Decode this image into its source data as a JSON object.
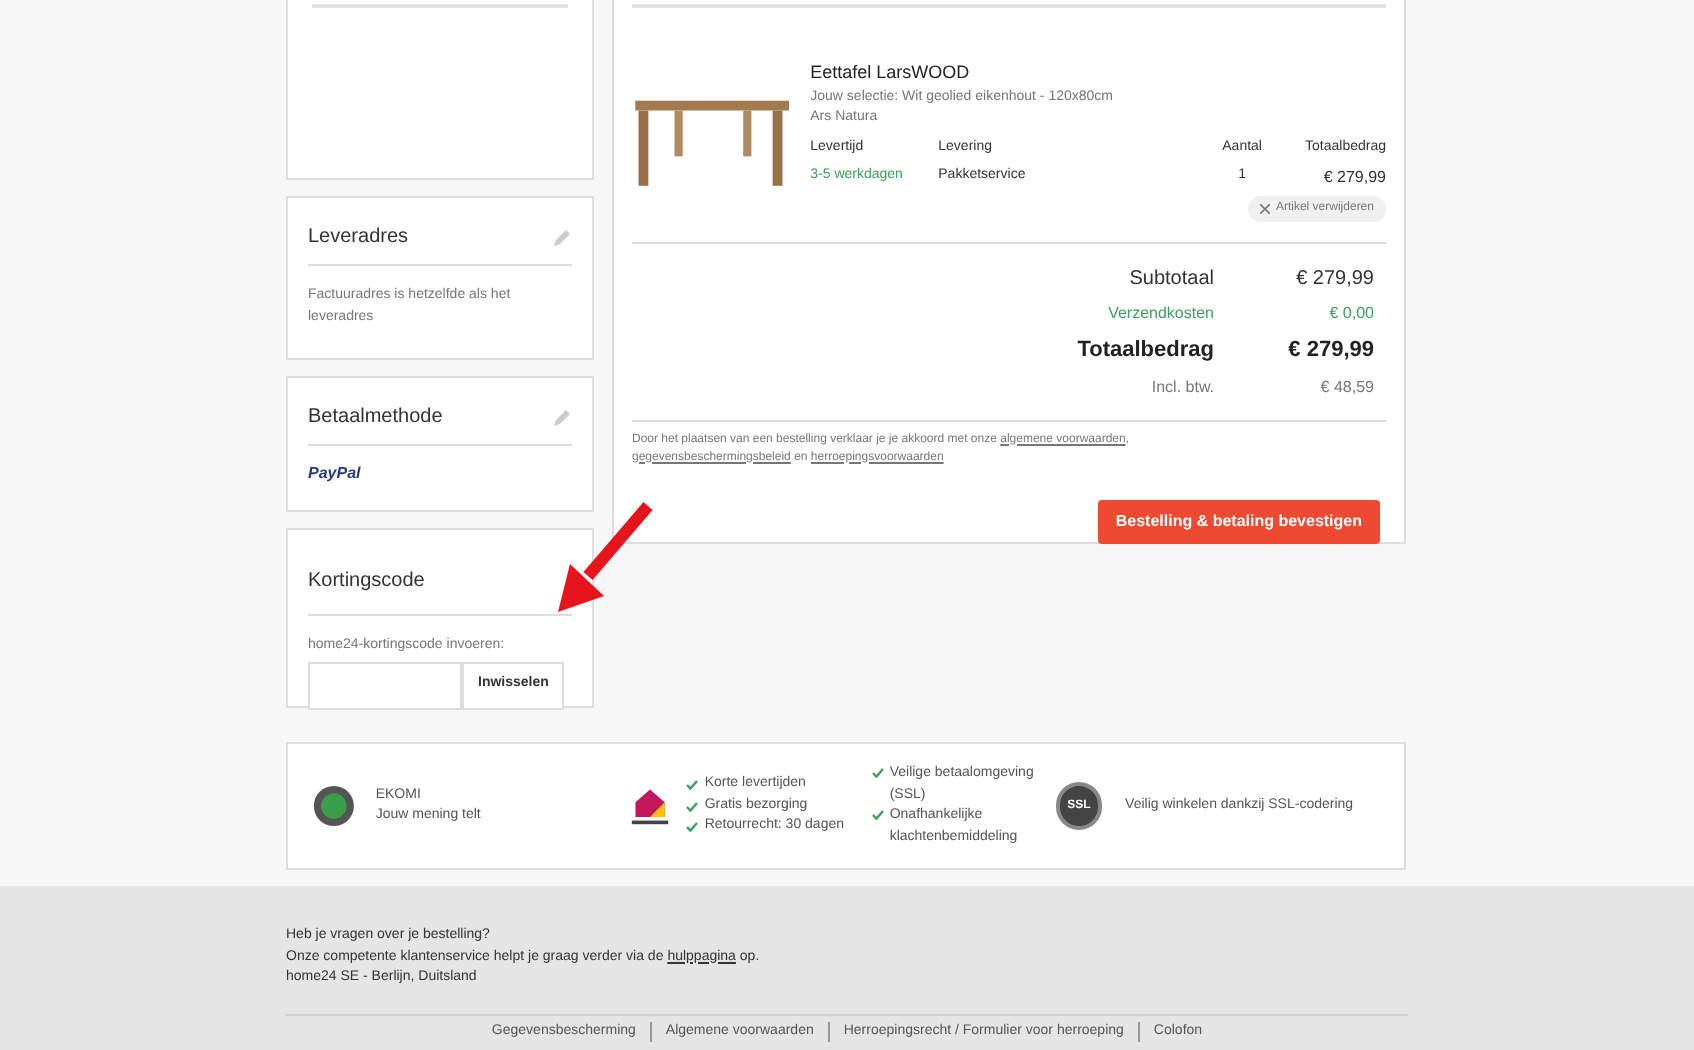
{
  "sidebar": {
    "address": {
      "title": "Leveradres",
      "text": "Factuuradres is hetzelfde als het leveradres"
    },
    "payment": {
      "title": "Betaalmethode",
      "method": "PayPal"
    },
    "coupon": {
      "title": "Kortingscode",
      "label": "home24-kortingscode invoeren:",
      "button": "Inwisselen"
    }
  },
  "order": {
    "product": {
      "name": "Eettafel LarsWOOD",
      "selection": "Jouw selectie: Wit geolied eikenhout - 120x80cm",
      "brand": "Ars Natura",
      "columns": [
        {
          "label": "Levertijd",
          "value": "3-5 werkdagen",
          "kind": "green"
        },
        {
          "label": "Levering",
          "value": "Pakketservice",
          "kind": "plain"
        },
        {
          "label": "Aantal",
          "value": "1",
          "kind": "center"
        },
        {
          "label": "Totaalbedrag",
          "value": "€ 279,99",
          "kind": "right"
        }
      ],
      "remove": "Artikel verwijderen"
    },
    "summary": [
      {
        "label": "Subtotaal",
        "value": "€ 279,99",
        "kind": "normal"
      },
      {
        "label": "Verzendkosten",
        "value": "€ 0,00",
        "kind": "green"
      },
      {
        "label": "Totaalbedrag",
        "value": "€ 279,99",
        "kind": "total"
      },
      {
        "label": "Incl. btw.",
        "value": "€ 48,59",
        "kind": "small"
      }
    ],
    "terms": {
      "text": "Door het plaatsen van een bestelling verklaar je je akkoord met onze",
      "link1": "algemene voorwaarden",
      "separator": ",",
      "link2": "gegevensbeschermingsbeleid",
      "middle": "en",
      "link3": "herroepingsvoorwaarden"
    },
    "confirm": "Bestelling & betaling bevestigen"
  },
  "trust": {
    "ekomi": {
      "title": "EKOMI",
      "subtitle": "Jouw mening telt"
    },
    "checks1": [
      "Korte levertijden",
      "Gratis bezorging",
      "Retourrecht: 30 dagen"
    ],
    "checks2": [
      "Veilige betaalomgeving (SSL)",
      "Onafhankelijke klachtenbemiddeling"
    ],
    "ssl": {
      "badge": "SSL",
      "text": "Veilig winkelen dankzij SSL-codering"
    }
  },
  "footer": {
    "question": "Heb je vragen over je bestelling?",
    "help_before": "Onze competente klantenservice helpt je graag verder via de",
    "help_link": "hulppagina",
    "help_after": "op.",
    "address": "home24 SE - Berlijn, Duitsland",
    "links": [
      "Gegevensbescherming",
      "Algemene voorwaarden",
      "Herroepingsrecht / Formulier voor herroeping",
      "Colofon"
    ]
  }
}
